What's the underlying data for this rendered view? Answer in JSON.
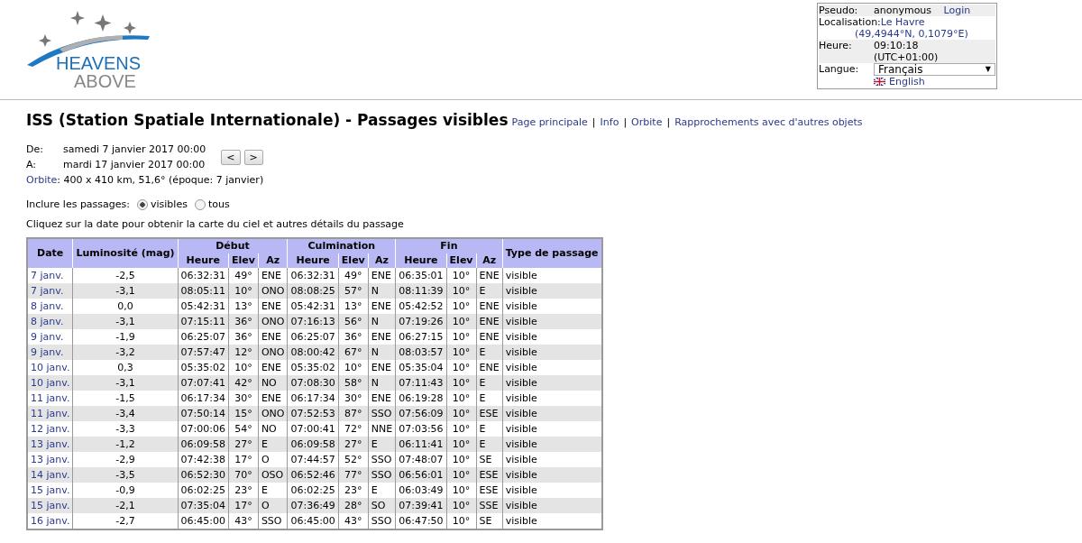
{
  "logo": {
    "line1": "HEAVENS",
    "line2": "ABOVE"
  },
  "user_box": {
    "pseudo_label": "Pseudo:",
    "pseudo": "anonymous",
    "login": "Login",
    "location_label": "Localisation:",
    "location": "Le Havre",
    "coords": "(49,4944°N, 0,1079°E)",
    "time_label": "Heure:",
    "time": "09:10:18",
    "timezone": "(UTC+01:00)",
    "language_label": "Langue:",
    "language": "Français",
    "dropdown_arrow": "▼",
    "alt_language": "English"
  },
  "title": "ISS (Station Spatiale Internationale) - Passages visibles",
  "nav_links": [
    "Page principale",
    "Info",
    "Orbite",
    "Rapprochements avec d'autres objets"
  ],
  "nav_separator": "|",
  "period": {
    "from_label": "De:",
    "from": "samedi 7 janvier 2017 00:00",
    "to_label": "A:",
    "to": "mardi 17 janvier 2017 00:00",
    "orbit_link": "Orbite",
    "orbit": ": 400 x 410 km, 51,6° (époque: 7 janvier)",
    "prev": "<",
    "next": ">"
  },
  "include": {
    "label": "Inclure les passages:",
    "options": [
      {
        "label": "visibles",
        "selected": true
      },
      {
        "label": "tous",
        "selected": false
      }
    ]
  },
  "hint": "Cliquez sur la date pour obtenir la carte du ciel et autres détails du passage",
  "table": {
    "top_headers": [
      "Date",
      "Luminosité (mag)",
      "Début",
      "Culmination",
      "Fin",
      "Type de passage"
    ],
    "sub_headers": [
      "Heure",
      "Elev",
      "Az",
      "Heure",
      "Elev",
      "Az",
      "Heure",
      "Elev",
      "Az"
    ],
    "rows": [
      [
        "7 janv.",
        "-2,5",
        "06:32:31",
        "49°",
        "ENE",
        "06:32:31",
        "49°",
        "ENE",
        "06:35:01",
        "10°",
        "ENE",
        "visible"
      ],
      [
        "7 janv.",
        "-3,1",
        "08:05:11",
        "10°",
        "ONO",
        "08:08:25",
        "57°",
        "N",
        "08:11:39",
        "10°",
        "E",
        "visible"
      ],
      [
        "8 janv.",
        "0,0",
        "05:42:31",
        "13°",
        "ENE",
        "05:42:31",
        "13°",
        "ENE",
        "05:42:52",
        "10°",
        "ENE",
        "visible"
      ],
      [
        "8 janv.",
        "-3,1",
        "07:15:11",
        "36°",
        "ONO",
        "07:16:13",
        "56°",
        "N",
        "07:19:26",
        "10°",
        "ENE",
        "visible"
      ],
      [
        "9 janv.",
        "-1,9",
        "06:25:07",
        "36°",
        "ENE",
        "06:25:07",
        "36°",
        "ENE",
        "06:27:15",
        "10°",
        "ENE",
        "visible"
      ],
      [
        "9 janv.",
        "-3,2",
        "07:57:47",
        "12°",
        "ONO",
        "08:00:42",
        "67°",
        "N",
        "08:03:57",
        "10°",
        "E",
        "visible"
      ],
      [
        "10 janv.",
        "0,3",
        "05:35:02",
        "10°",
        "ENE",
        "05:35:02",
        "10°",
        "ENE",
        "05:35:04",
        "10°",
        "ENE",
        "visible"
      ],
      [
        "10 janv.",
        "-3,1",
        "07:07:41",
        "42°",
        "NO",
        "07:08:30",
        "58°",
        "N",
        "07:11:43",
        "10°",
        "E",
        "visible"
      ],
      [
        "11 janv.",
        "-1,5",
        "06:17:34",
        "30°",
        "ENE",
        "06:17:34",
        "30°",
        "ENE",
        "06:19:28",
        "10°",
        "E",
        "visible"
      ],
      [
        "11 janv.",
        "-3,4",
        "07:50:14",
        "15°",
        "ONO",
        "07:52:53",
        "87°",
        "SSO",
        "07:56:09",
        "10°",
        "ESE",
        "visible"
      ],
      [
        "12 janv.",
        "-3,3",
        "07:00:06",
        "54°",
        "NO",
        "07:00:41",
        "72°",
        "NNE",
        "07:03:56",
        "10°",
        "E",
        "visible"
      ],
      [
        "13 janv.",
        "-1,2",
        "06:09:58",
        "27°",
        "E",
        "06:09:58",
        "27°",
        "E",
        "06:11:41",
        "10°",
        "E",
        "visible"
      ],
      [
        "13 janv.",
        "-2,9",
        "07:42:38",
        "17°",
        "O",
        "07:44:57",
        "52°",
        "SSO",
        "07:48:07",
        "10°",
        "SE",
        "visible"
      ],
      [
        "14 janv.",
        "-3,5",
        "06:52:30",
        "70°",
        "OSO",
        "06:52:46",
        "77°",
        "SSO",
        "06:56:01",
        "10°",
        "ESE",
        "visible"
      ],
      [
        "15 janv.",
        "-0,9",
        "06:02:25",
        "23°",
        "E",
        "06:02:25",
        "23°",
        "E",
        "06:03:49",
        "10°",
        "ESE",
        "visible"
      ],
      [
        "15 janv.",
        "-2,1",
        "07:35:04",
        "17°",
        "O",
        "07:36:49",
        "28°",
        "SO",
        "07:39:41",
        "10°",
        "SSE",
        "visible"
      ],
      [
        "16 janv.",
        "-2,7",
        "06:45:00",
        "43°",
        "SSO",
        "06:45:00",
        "43°",
        "SSO",
        "06:47:50",
        "10°",
        "SE",
        "visible"
      ]
    ]
  }
}
